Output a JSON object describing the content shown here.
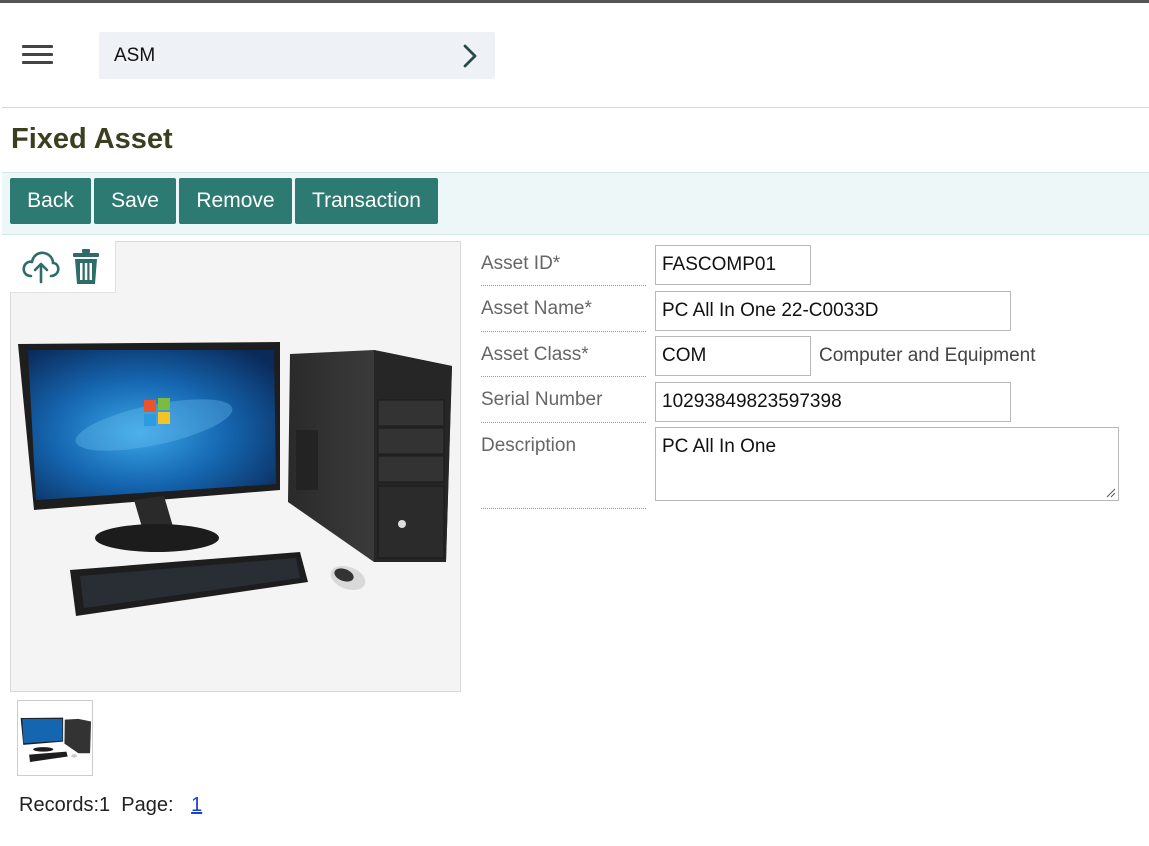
{
  "header": {
    "menu_icon": "hamburger-menu-icon",
    "breadcrumb": "ASM",
    "breadcrumb_icon": "chevron-right-icon"
  },
  "page": {
    "title": "Fixed Asset"
  },
  "toolbar": {
    "back": "Back",
    "save": "Save",
    "remove": "Remove",
    "transaction": "Transaction"
  },
  "image": {
    "upload_icon": "cloud-upload-icon",
    "delete_icon": "trash-icon",
    "subject": "desktop-computer-photo"
  },
  "form": {
    "asset_id": {
      "label": "Asset ID*",
      "value": "FASCOMP01"
    },
    "asset_name": {
      "label": "Asset Name*",
      "value": "PC All In One 22-C0033D"
    },
    "asset_class": {
      "label": "Asset Class*",
      "value": "COM",
      "description": "Computer and Equipment"
    },
    "serial_number": {
      "label": "Serial Number",
      "value": "10293849823597398"
    },
    "description": {
      "label": "Description",
      "value": "PC All In One"
    }
  },
  "pagination": {
    "records_text": "Records:1",
    "page_label": "Page:",
    "current_page": "1"
  },
  "colors": {
    "button_bg": "#2d7a72",
    "toolbar_bg": "#eef7f7",
    "title_color": "#3c3f1f",
    "link_color": "#1a3fcf"
  }
}
